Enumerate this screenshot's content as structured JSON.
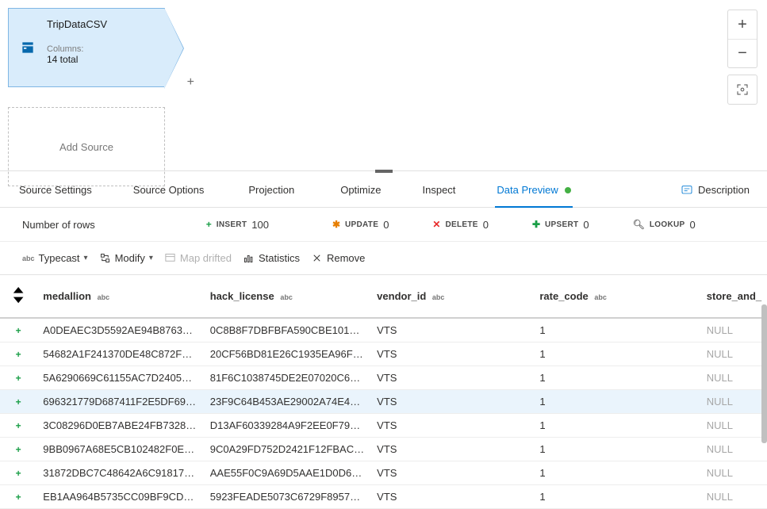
{
  "node": {
    "title": "TripDataCSV",
    "columns_label": "Columns:",
    "columns_value": "14 total"
  },
  "add_source": "Add Source",
  "tabs": [
    "Source Settings",
    "Source Options",
    "Projection",
    "Optimize",
    "Inspect",
    "Data Preview"
  ],
  "active_tab": "Data Preview",
  "description_label": "Description",
  "rows_label": "Number of rows",
  "stats": {
    "insert": {
      "label": "INSERT",
      "value": "100"
    },
    "update": {
      "label": "UPDATE",
      "value": "0"
    },
    "delete": {
      "label": "DELETE",
      "value": "0"
    },
    "upsert": {
      "label": "UPSERT",
      "value": "0"
    },
    "lookup": {
      "label": "LOOKUP",
      "value": "0"
    }
  },
  "toolbar": {
    "typecast": "Typecast",
    "modify": "Modify",
    "map_drifted": "Map drifted",
    "statistics": "Statistics",
    "remove": "Remove"
  },
  "columns": [
    "medallion",
    "hack_license",
    "vendor_id",
    "rate_code",
    "store_and_"
  ],
  "rows": [
    {
      "medallion": "A0DEAEC3D5592AE94B87635…",
      "hack_license": "0C8B8F7DBFBFA590CBE10177…",
      "vendor_id": "VTS",
      "rate_code": "1",
      "store": "NULL"
    },
    {
      "medallion": "54682A1F241370DE48C872FE…",
      "hack_license": "20CF56BD81E26C1935EA96F9…",
      "vendor_id": "VTS",
      "rate_code": "1",
      "store": "NULL"
    },
    {
      "medallion": "5A6290669C61155AC7D2405…",
      "hack_license": "81F6C1038745DE2E07020C64…",
      "vendor_id": "VTS",
      "rate_code": "1",
      "store": "NULL"
    },
    {
      "medallion": "696321779D687411F2E5DF69…",
      "hack_license": "23F9C64B453AE29002A74E46…",
      "vendor_id": "VTS",
      "rate_code": "1",
      "store": "NULL"
    },
    {
      "medallion": "3C08296D0EB7ABE24FB7328…",
      "hack_license": "D13AF60339284A9F2EE0F791…",
      "vendor_id": "VTS",
      "rate_code": "1",
      "store": "NULL"
    },
    {
      "medallion": "9BB0967A68E5CB102482F0E1…",
      "hack_license": "9C0A29FD752D2421F12FBAC…",
      "vendor_id": "VTS",
      "rate_code": "1",
      "store": "NULL"
    },
    {
      "medallion": "31872DBC7C48642A6C91817…",
      "hack_license": "AAE55F0C9A69D5AAE1D0D6F…",
      "vendor_id": "VTS",
      "rate_code": "1",
      "store": "NULL"
    },
    {
      "medallion": "EB1AA964B5735CC09BF9CD4…",
      "hack_license": "5923FEADE5073C6729F8957E…",
      "vendor_id": "VTS",
      "rate_code": "1",
      "store": "NULL"
    }
  ],
  "highlight_row": 3
}
